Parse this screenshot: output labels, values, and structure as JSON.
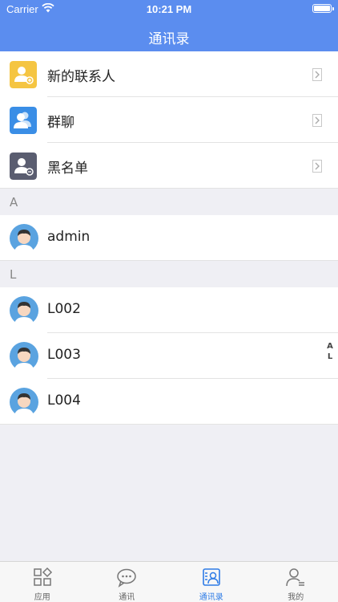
{
  "status_bar": {
    "carrier": "Carrier",
    "time": "10:21 PM"
  },
  "nav": {
    "title": "通讯录"
  },
  "menu": [
    {
      "label": "新的联系人",
      "icon": "new-contact-icon",
      "color": "#f5c542"
    },
    {
      "label": "群聊",
      "icon": "group-chat-icon",
      "color": "#3a8ee6"
    },
    {
      "label": "黑名单",
      "icon": "blacklist-icon",
      "color": "#5a5d70"
    }
  ],
  "sections": [
    {
      "letter": "A",
      "contacts": [
        {
          "name": "admin"
        }
      ]
    },
    {
      "letter": "L",
      "contacts": [
        {
          "name": "L002"
        },
        {
          "name": "L003"
        },
        {
          "name": "L004"
        }
      ]
    }
  ],
  "index_bar": [
    "A",
    "L"
  ],
  "tabs": [
    {
      "label": "应用",
      "icon": "apps-icon",
      "active": false
    },
    {
      "label": "通讯",
      "icon": "chat-icon",
      "active": false
    },
    {
      "label": "通讯录",
      "icon": "contacts-icon",
      "active": true
    },
    {
      "label": "我的",
      "icon": "profile-icon",
      "active": false
    }
  ],
  "colors": {
    "accent": "#5b8def",
    "tab_active": "#2f7ce6"
  }
}
